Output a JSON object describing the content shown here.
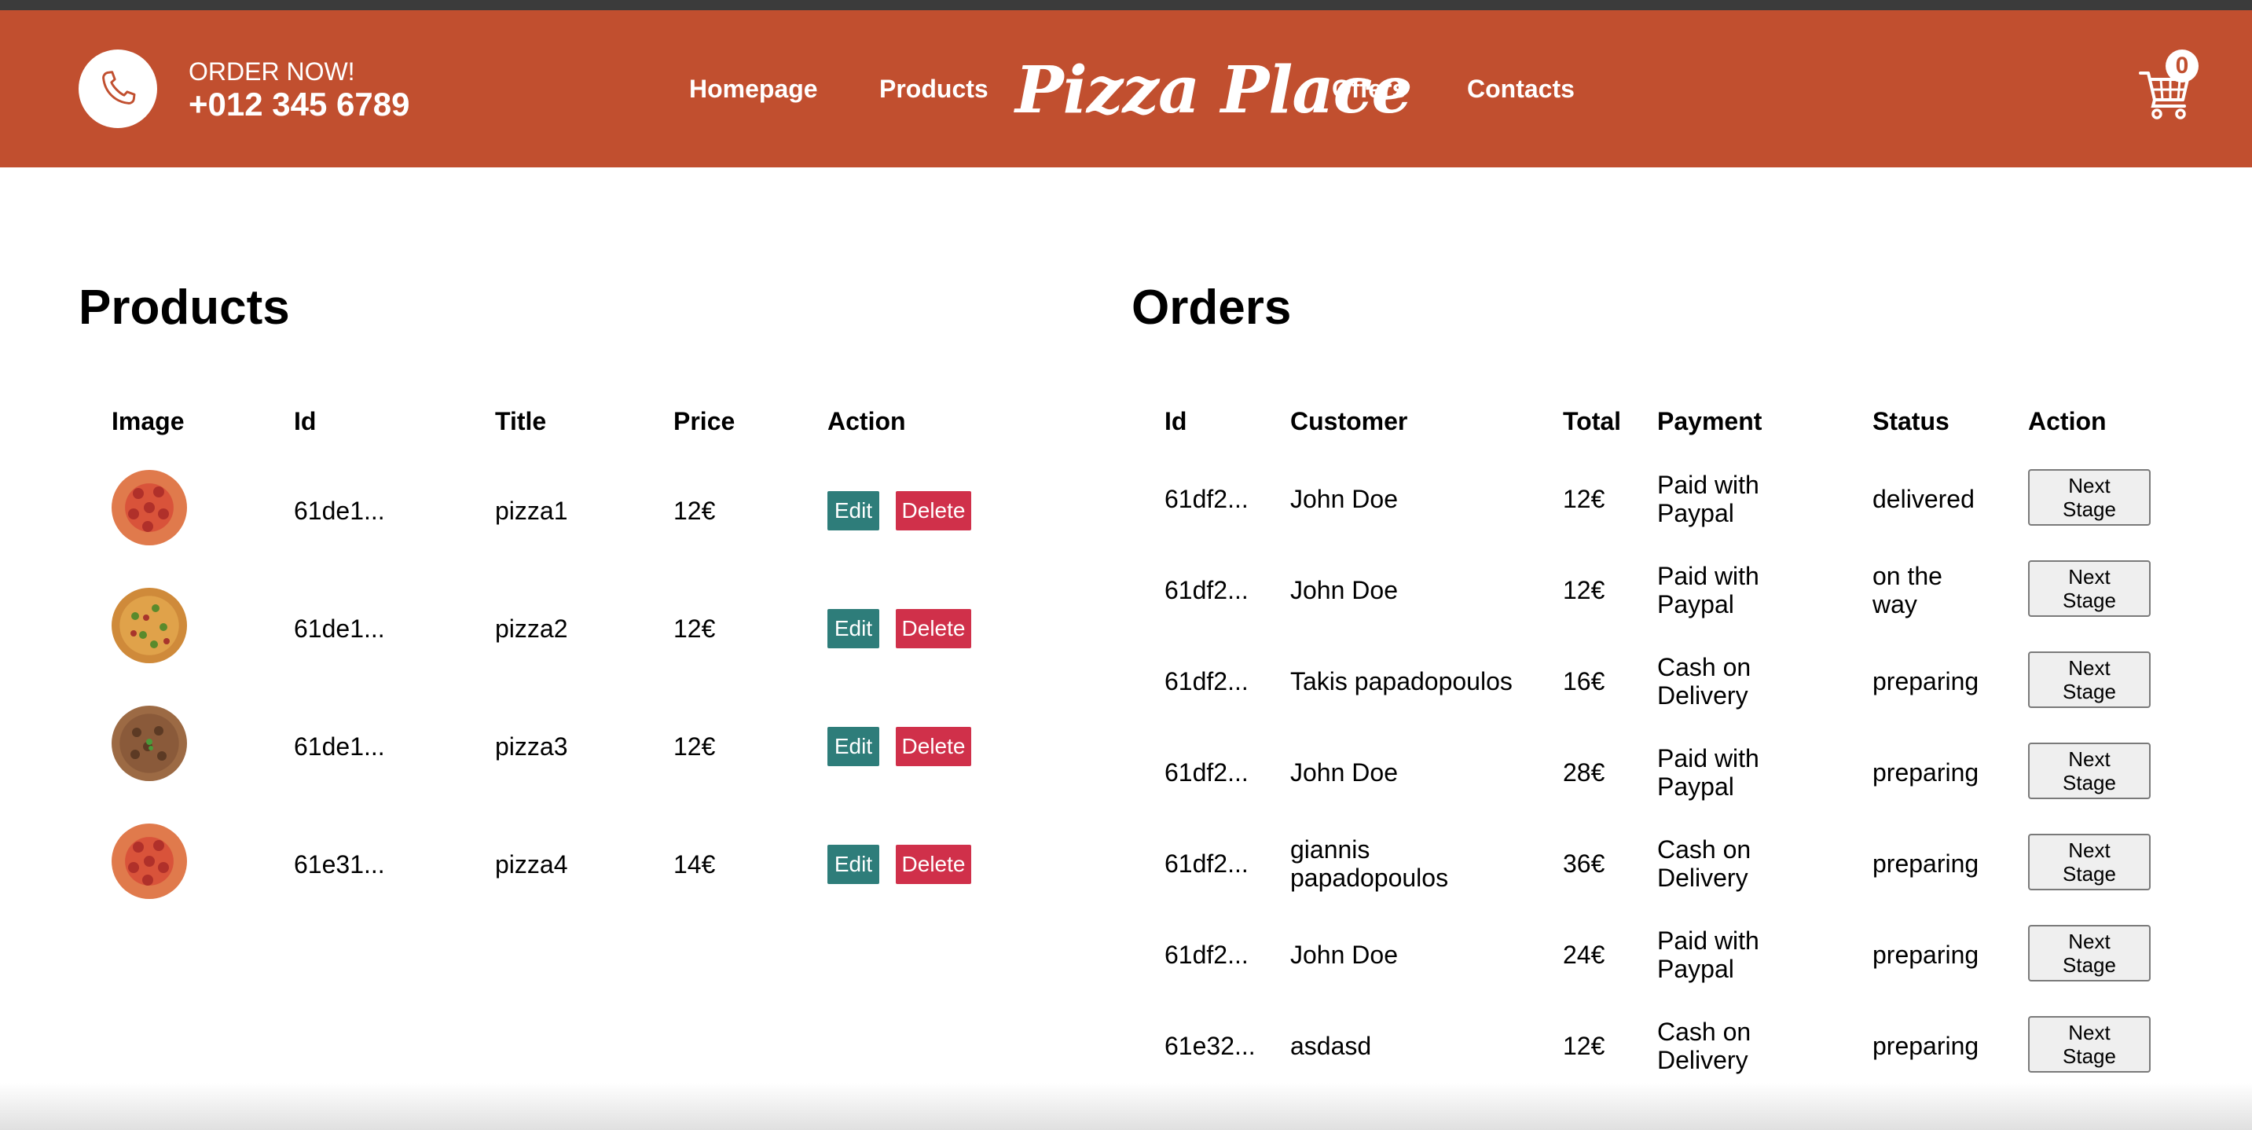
{
  "header": {
    "order_label": "ORDER NOW!",
    "phone": "+012 345 6789",
    "nav": [
      "Homepage",
      "Products",
      "Offers",
      "Contacts"
    ],
    "logo": "Pizza Place",
    "cart_count": "0",
    "icons": {
      "phone": "phone-icon",
      "cart": "cart-icon"
    },
    "colors": {
      "bar": "#c14f2f",
      "edit": "#2e7d7a",
      "delete": "#d0304a"
    }
  },
  "products": {
    "title": "Products",
    "columns": [
      "Image",
      "Id",
      "Title",
      "Price",
      "Action"
    ],
    "rows": [
      {
        "image": "pepperoni-pizza",
        "id": "61de1...",
        "title": "pizza1",
        "price": "12€"
      },
      {
        "image": "vegetable-pizza",
        "id": "61de1...",
        "title": "pizza2",
        "price": "12€"
      },
      {
        "image": "meat-pizza",
        "id": "61de1...",
        "title": "pizza3",
        "price": "12€"
      },
      {
        "image": "pepperoni-pizza",
        "id": "61e31...",
        "title": "pizza4",
        "price": "14€"
      }
    ],
    "edit_label": "Edit",
    "delete_label": "Delete"
  },
  "orders": {
    "title": "Orders",
    "columns": [
      "Id",
      "Customer",
      "Total",
      "Payment",
      "Status",
      "Action"
    ],
    "rows": [
      {
        "id": "61df2...",
        "customer": [
          "John Doe"
        ],
        "total": "12€",
        "payment": [
          "Paid with",
          "Paypal"
        ],
        "status": [
          "delivered"
        ]
      },
      {
        "id": "61df2...",
        "customer": [
          "John Doe"
        ],
        "total": "12€",
        "payment": [
          "Paid with",
          "Paypal"
        ],
        "status": [
          "on the",
          "way"
        ]
      },
      {
        "id": "61df2...",
        "customer": [
          "Takis papadopoulos"
        ],
        "total": "16€",
        "payment": [
          "Cash on",
          "Delivery"
        ],
        "status": [
          "preparing"
        ]
      },
      {
        "id": "61df2...",
        "customer": [
          "John Doe"
        ],
        "total": "28€",
        "payment": [
          "Paid with",
          "Paypal"
        ],
        "status": [
          "preparing"
        ]
      },
      {
        "id": "61df2...",
        "customer": [
          "giannis",
          "papadopoulos"
        ],
        "total": "36€",
        "payment": [
          "Cash on",
          "Delivery"
        ],
        "status": [
          "preparing"
        ]
      },
      {
        "id": "61df2...",
        "customer": [
          "John Doe"
        ],
        "total": "24€",
        "payment": [
          "Paid with",
          "Paypal"
        ],
        "status": [
          "preparing"
        ]
      },
      {
        "id": "61e32...",
        "customer": [
          "asdasd"
        ],
        "total": "12€",
        "payment": [
          "Cash on",
          "Delivery"
        ],
        "status": [
          "preparing"
        ]
      }
    ],
    "next_label": [
      "Next",
      "Stage"
    ]
  }
}
